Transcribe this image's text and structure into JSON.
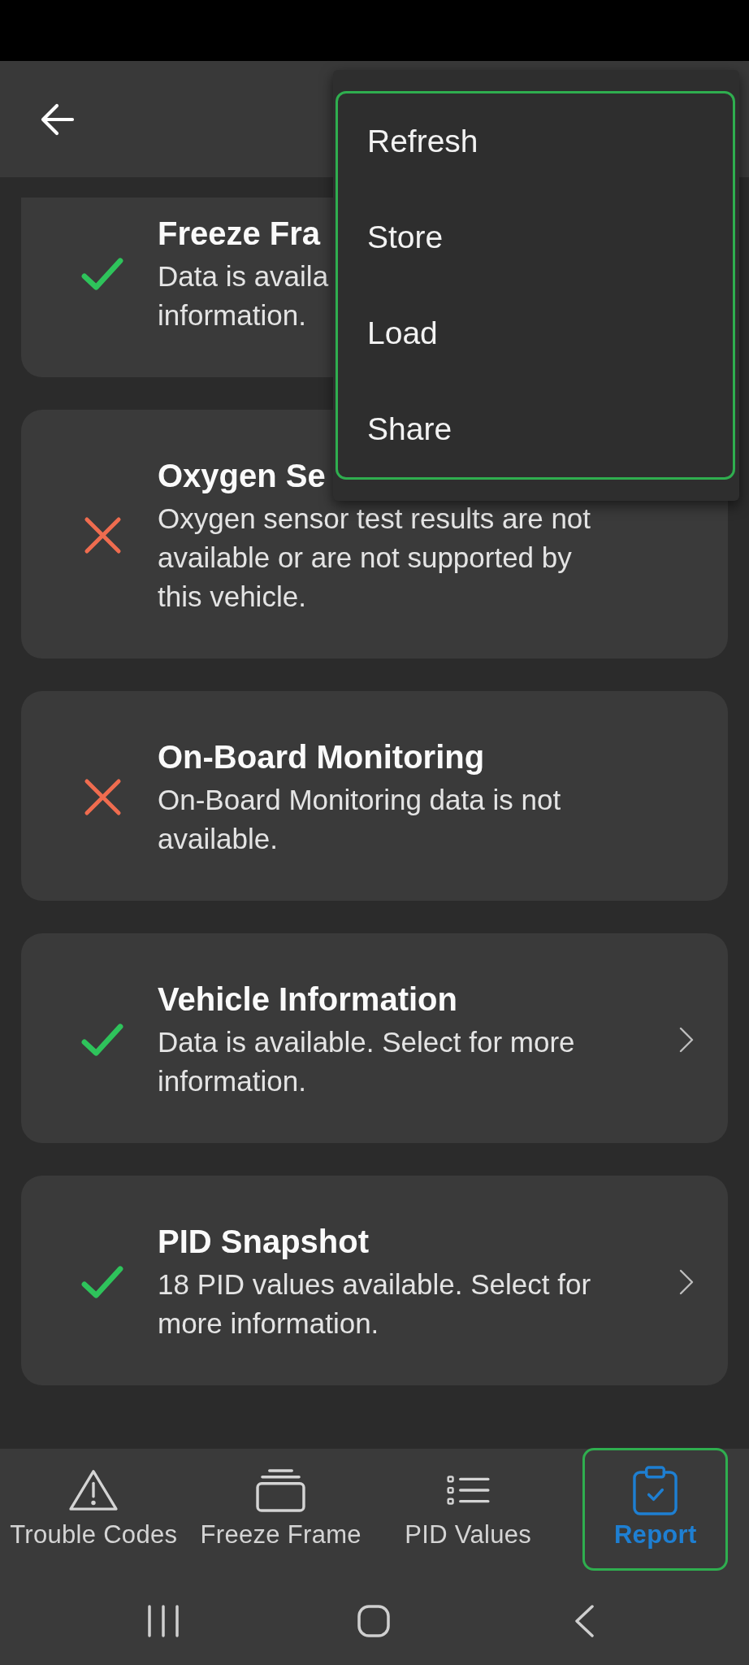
{
  "menu": {
    "highlighted": true,
    "items": [
      {
        "label": "Refresh"
      },
      {
        "label": "Store"
      },
      {
        "label": "Load"
      },
      {
        "label": "Share"
      }
    ]
  },
  "cards": [
    {
      "title": "Freeze Fra",
      "description": "Data is availa\ninformation.",
      "available": true,
      "chevron": false
    },
    {
      "title": "Oxygen Se",
      "description": "Oxygen sensor test results are not available or are not supported by this vehicle.",
      "available": false,
      "chevron": false
    },
    {
      "title": "On-Board Monitoring",
      "description": "On-Board Monitoring data is not available.",
      "available": false,
      "chevron": false
    },
    {
      "title": "Vehicle Information",
      "description": "Data is available. Select for more information.",
      "available": true,
      "chevron": true
    },
    {
      "title": "PID Snapshot",
      "description": "18 PID values available. Select for more information.",
      "available": true,
      "chevron": true
    }
  ],
  "bottom_nav": [
    {
      "label": "Trouble Codes",
      "selected": false,
      "highlighted": false
    },
    {
      "label": "Freeze Frame",
      "selected": false,
      "highlighted": false
    },
    {
      "label": "PID Values",
      "selected": false,
      "highlighted": false
    },
    {
      "label": "Report",
      "selected": true,
      "highlighted": true
    }
  ]
}
